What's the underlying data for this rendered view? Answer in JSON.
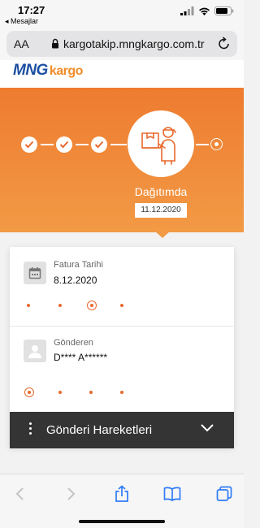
{
  "statusbar": {
    "time": "17:27",
    "back_app": "◂ Mesajlar"
  },
  "browser": {
    "text_size": "AA",
    "url": "kargotakip.mngkargo.com.tr"
  },
  "site": {
    "logo_mng": "MNG",
    "logo_kargo": "kargo"
  },
  "tracking": {
    "status": "Dağıtımda",
    "date": "11.12.2020"
  },
  "details": {
    "invoice_label": "Fatura Tarihi",
    "invoice_value": "8.12.2020",
    "sender_label": "Gönderen",
    "sender_value": "D**** A******"
  },
  "movements": {
    "label": "Gönderi Hareketleri"
  },
  "colors": {
    "accent": "#e8692d",
    "hero_top": "#ee7b30",
    "hero_bottom": "#f29a45",
    "brand_blue": "#1c4fa3",
    "dark_bar": "#343434"
  },
  "icons": [
    "calendar-icon",
    "user-icon",
    "courier-icon",
    "lock-icon",
    "reload-icon",
    "share-icon",
    "bookmarks-icon",
    "tabs-icon",
    "chevron-down-icon",
    "kebab-icon"
  ]
}
